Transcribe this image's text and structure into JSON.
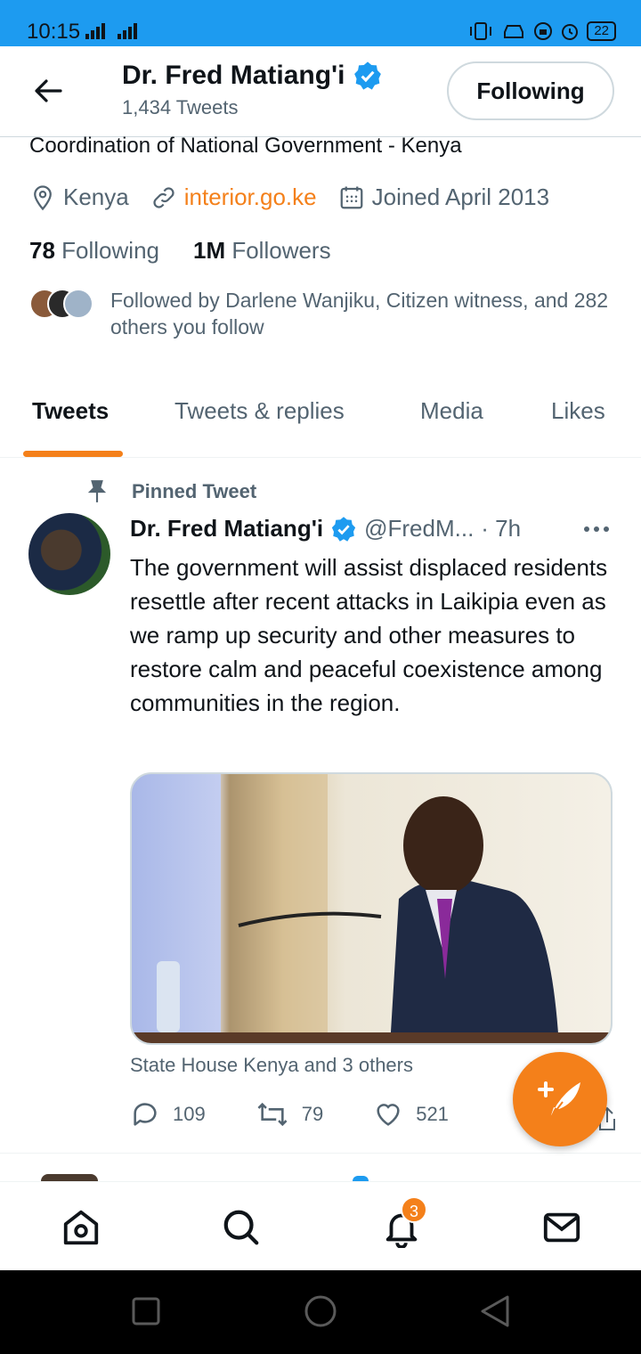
{
  "status_bar": {
    "time": "10:15",
    "battery": "22"
  },
  "header": {
    "name": "Dr. Fred Matiang'i",
    "tweet_count": "1,434 Tweets",
    "follow_label": "Following"
  },
  "profile": {
    "bio": "Coordination of National Government - Kenya",
    "location": "Kenya",
    "website": "interior.go.ke",
    "joined": "Joined April 2013",
    "following_count": "78",
    "following_label": "Following",
    "followers_count": "1M",
    "followers_label": "Followers",
    "followed_by": "Followed by Darlene Wanjiku, Citizen witness, and 282 others you follow"
  },
  "tabs": [
    "Tweets",
    "Tweets & replies",
    "Media",
    "Likes"
  ],
  "tweet": {
    "pinned_label": "Pinned Tweet",
    "author": "Dr. Fred Matiang'i",
    "handle": "@FredM...",
    "time": "· 7h",
    "text": "The government will assist displaced residents resettle after recent attacks in Laikipia even as we ramp up security and other measures to restore calm and peaceful coexistence among communities in the region.",
    "tagged": "State House Kenya and 3 others",
    "replies": "109",
    "retweets": "79",
    "likes": "521"
  },
  "bottom_nav": {
    "notification_badge": "3"
  },
  "colors": {
    "accent": "#f4801a",
    "verified": "#1d9bf0",
    "status_bar": "#1d9bf0",
    "secondary_text": "#536471"
  },
  "icons": [
    "back-arrow-icon",
    "verified-badge-icon",
    "location-pin-icon",
    "link-icon",
    "calendar-icon",
    "pin-icon",
    "more-icon",
    "reply-icon",
    "retweet-icon",
    "like-icon",
    "share-icon",
    "compose-tweet-icon",
    "home-icon",
    "search-icon",
    "notifications-icon",
    "messages-icon"
  ]
}
